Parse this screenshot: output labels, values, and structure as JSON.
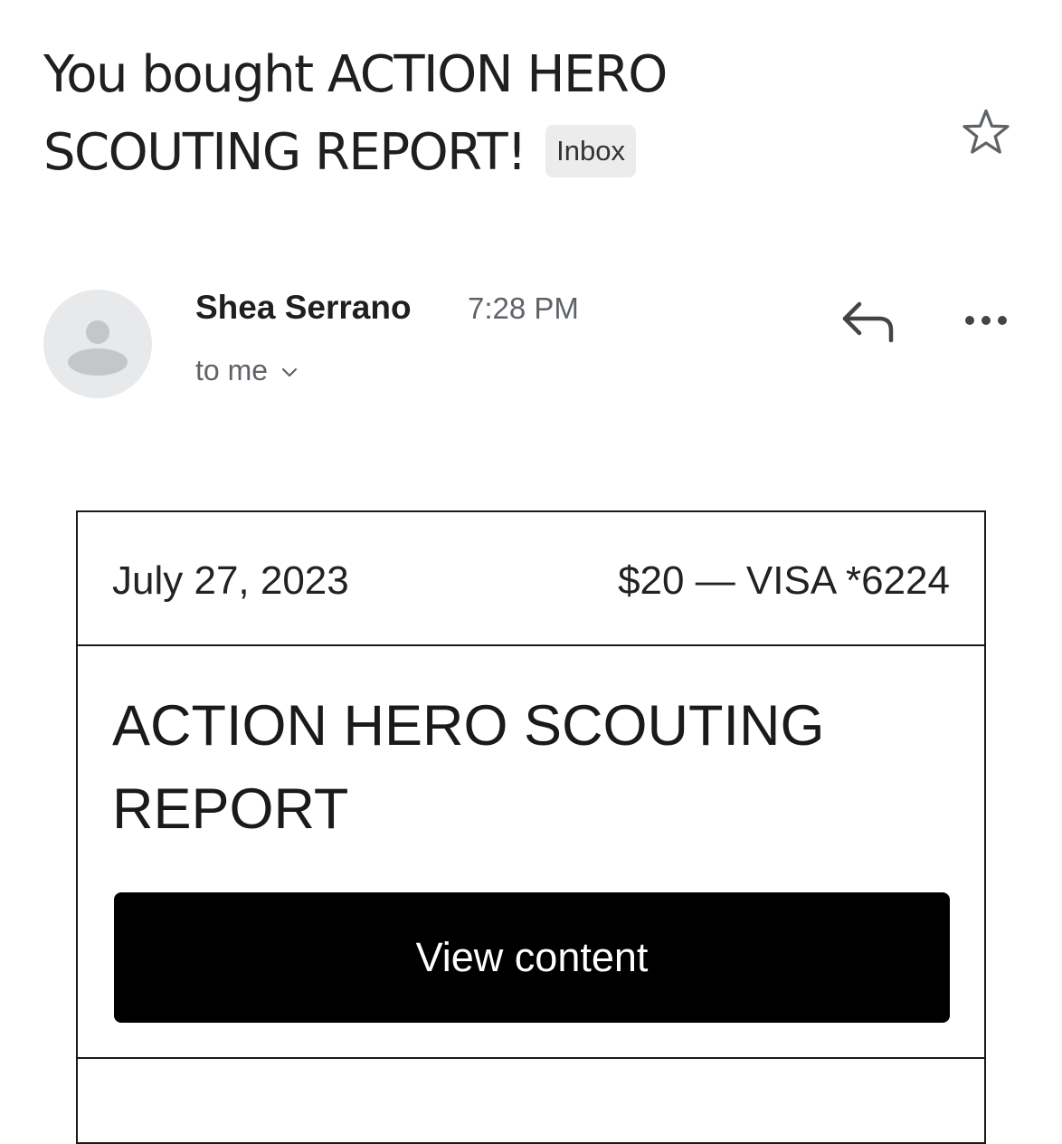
{
  "email": {
    "subject": "You bought ACTION HERO SCOUTING REPORT!",
    "label": "Inbox",
    "sender": {
      "name": "Shea Serrano",
      "time": "7:28 PM",
      "recipient": "to me",
      "avatar_icon": "person-avatar-icon"
    },
    "actions": {
      "star_icon": "star-outline-icon",
      "reply_icon": "reply-arrow-icon",
      "more_icon": "more-horizontal-icon"
    }
  },
  "receipt": {
    "date": "July 27, 2023",
    "payment": "$20 — VISA *6224",
    "product_title": "ACTION HERO SCOUTING REPORT",
    "button_label": "View content"
  },
  "colors": {
    "text": "#1f1f1f",
    "muted": "#5f6368",
    "badge_bg": "#ececec",
    "avatar_bg": "#e8e9eb",
    "avatar_figure": "#c4c6c9",
    "button_bg": "#000000",
    "button_text": "#ffffff",
    "border": "#1a1a1a"
  }
}
